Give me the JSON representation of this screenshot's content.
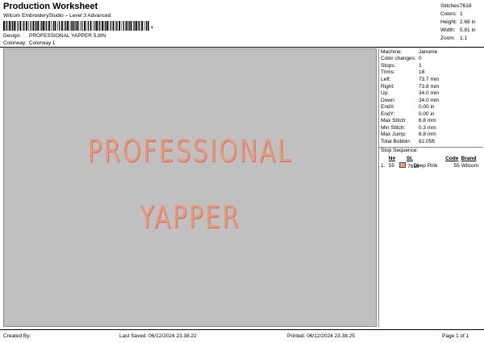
{
  "header": {
    "title": "Production Worksheet",
    "subtitle": "Wilcom EmbroideryStudio – Level 3 Advanced",
    "barcode_suffix": ","
  },
  "design_info": [
    {
      "label": "Design:",
      "value": "PROFESSIONAL YAPPER 5,8IN"
    },
    {
      "label": "Colorway:",
      "value": "Colorway 1"
    }
  ],
  "stats": [
    {
      "label": "Stitches:",
      "value": "7618"
    },
    {
      "label": "Colors:",
      "value": "1"
    },
    {
      "label": "Height:",
      "value": "2.68 in"
    },
    {
      "label": "Width:",
      "value": "5.81 in"
    },
    {
      "label": "Zoom:",
      "value": "1:1"
    }
  ],
  "design_text": {
    "line1": "PROFESSIONAL",
    "line2": "YAPPER",
    "thread_color": "#e59a82"
  },
  "machine_params": [
    {
      "label": "Machine:",
      "value": "Janome"
    },
    {
      "label": "Color changes:",
      "value": "0"
    },
    {
      "label": "Stops:",
      "value": "1"
    },
    {
      "label": "Trims:",
      "value": "18"
    },
    {
      "label": "Left:",
      "value": "73.7 mm"
    },
    {
      "label": "Right:",
      "value": "73.8 mm"
    },
    {
      "label": "Up:",
      "value": "34.0 mm"
    },
    {
      "label": "Down:",
      "value": "34.0 mm"
    },
    {
      "label": "EndX:",
      "value": "0.00 in"
    },
    {
      "label": "EndY:",
      "value": "0.00 in"
    },
    {
      "label": "Max Stitch:",
      "value": "6.8 mm"
    },
    {
      "label": "Min Stitch:",
      "value": "0.3 mm"
    },
    {
      "label": "Max Jump:",
      "value": "6.8 mm"
    },
    {
      "label": "Total Bobbin:",
      "value": "62.05ft"
    }
  ],
  "stop_sequence": {
    "heading": "Stop Sequence:",
    "columns": [
      "N#",
      "St.",
      "Code",
      "Brand"
    ],
    "rows": [
      {
        "index": "1.",
        "n": "55",
        "stitches": "7618",
        "name": "Deep Pink",
        "code": "55",
        "brand": "Wilcom",
        "color": "#e59a82"
      }
    ]
  },
  "footer": {
    "created_by": "Created By:",
    "last_saved": "Last Saved: 06/12/2024 23.38.22",
    "printed": "Printed: 06/12/2024 23.38.25",
    "page": "Page 1 of 1"
  }
}
